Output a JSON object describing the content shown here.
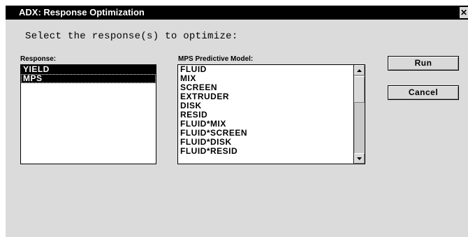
{
  "window": {
    "title": "ADX: Response Optimization",
    "close_glyph": "✕"
  },
  "prompt": "Select the response(s) to optimize:",
  "response_list": {
    "label": "Response:",
    "items": [
      "YIELD",
      "MPS"
    ]
  },
  "model_list": {
    "label": "MPS Predictive Model:",
    "items": [
      "FLUID",
      "MIX",
      "SCREEN",
      "EXTRUDER",
      "DISK",
      "RESID",
      "FLUID*MIX",
      "FLUID*SCREEN",
      "FLUID*DISK",
      "FLUID*RESID"
    ]
  },
  "buttons": {
    "run": "Run",
    "cancel": "Cancel"
  },
  "colors": {
    "titlebar": "#000000",
    "window_bg": "#dbdbdb",
    "selection": "#000000"
  }
}
